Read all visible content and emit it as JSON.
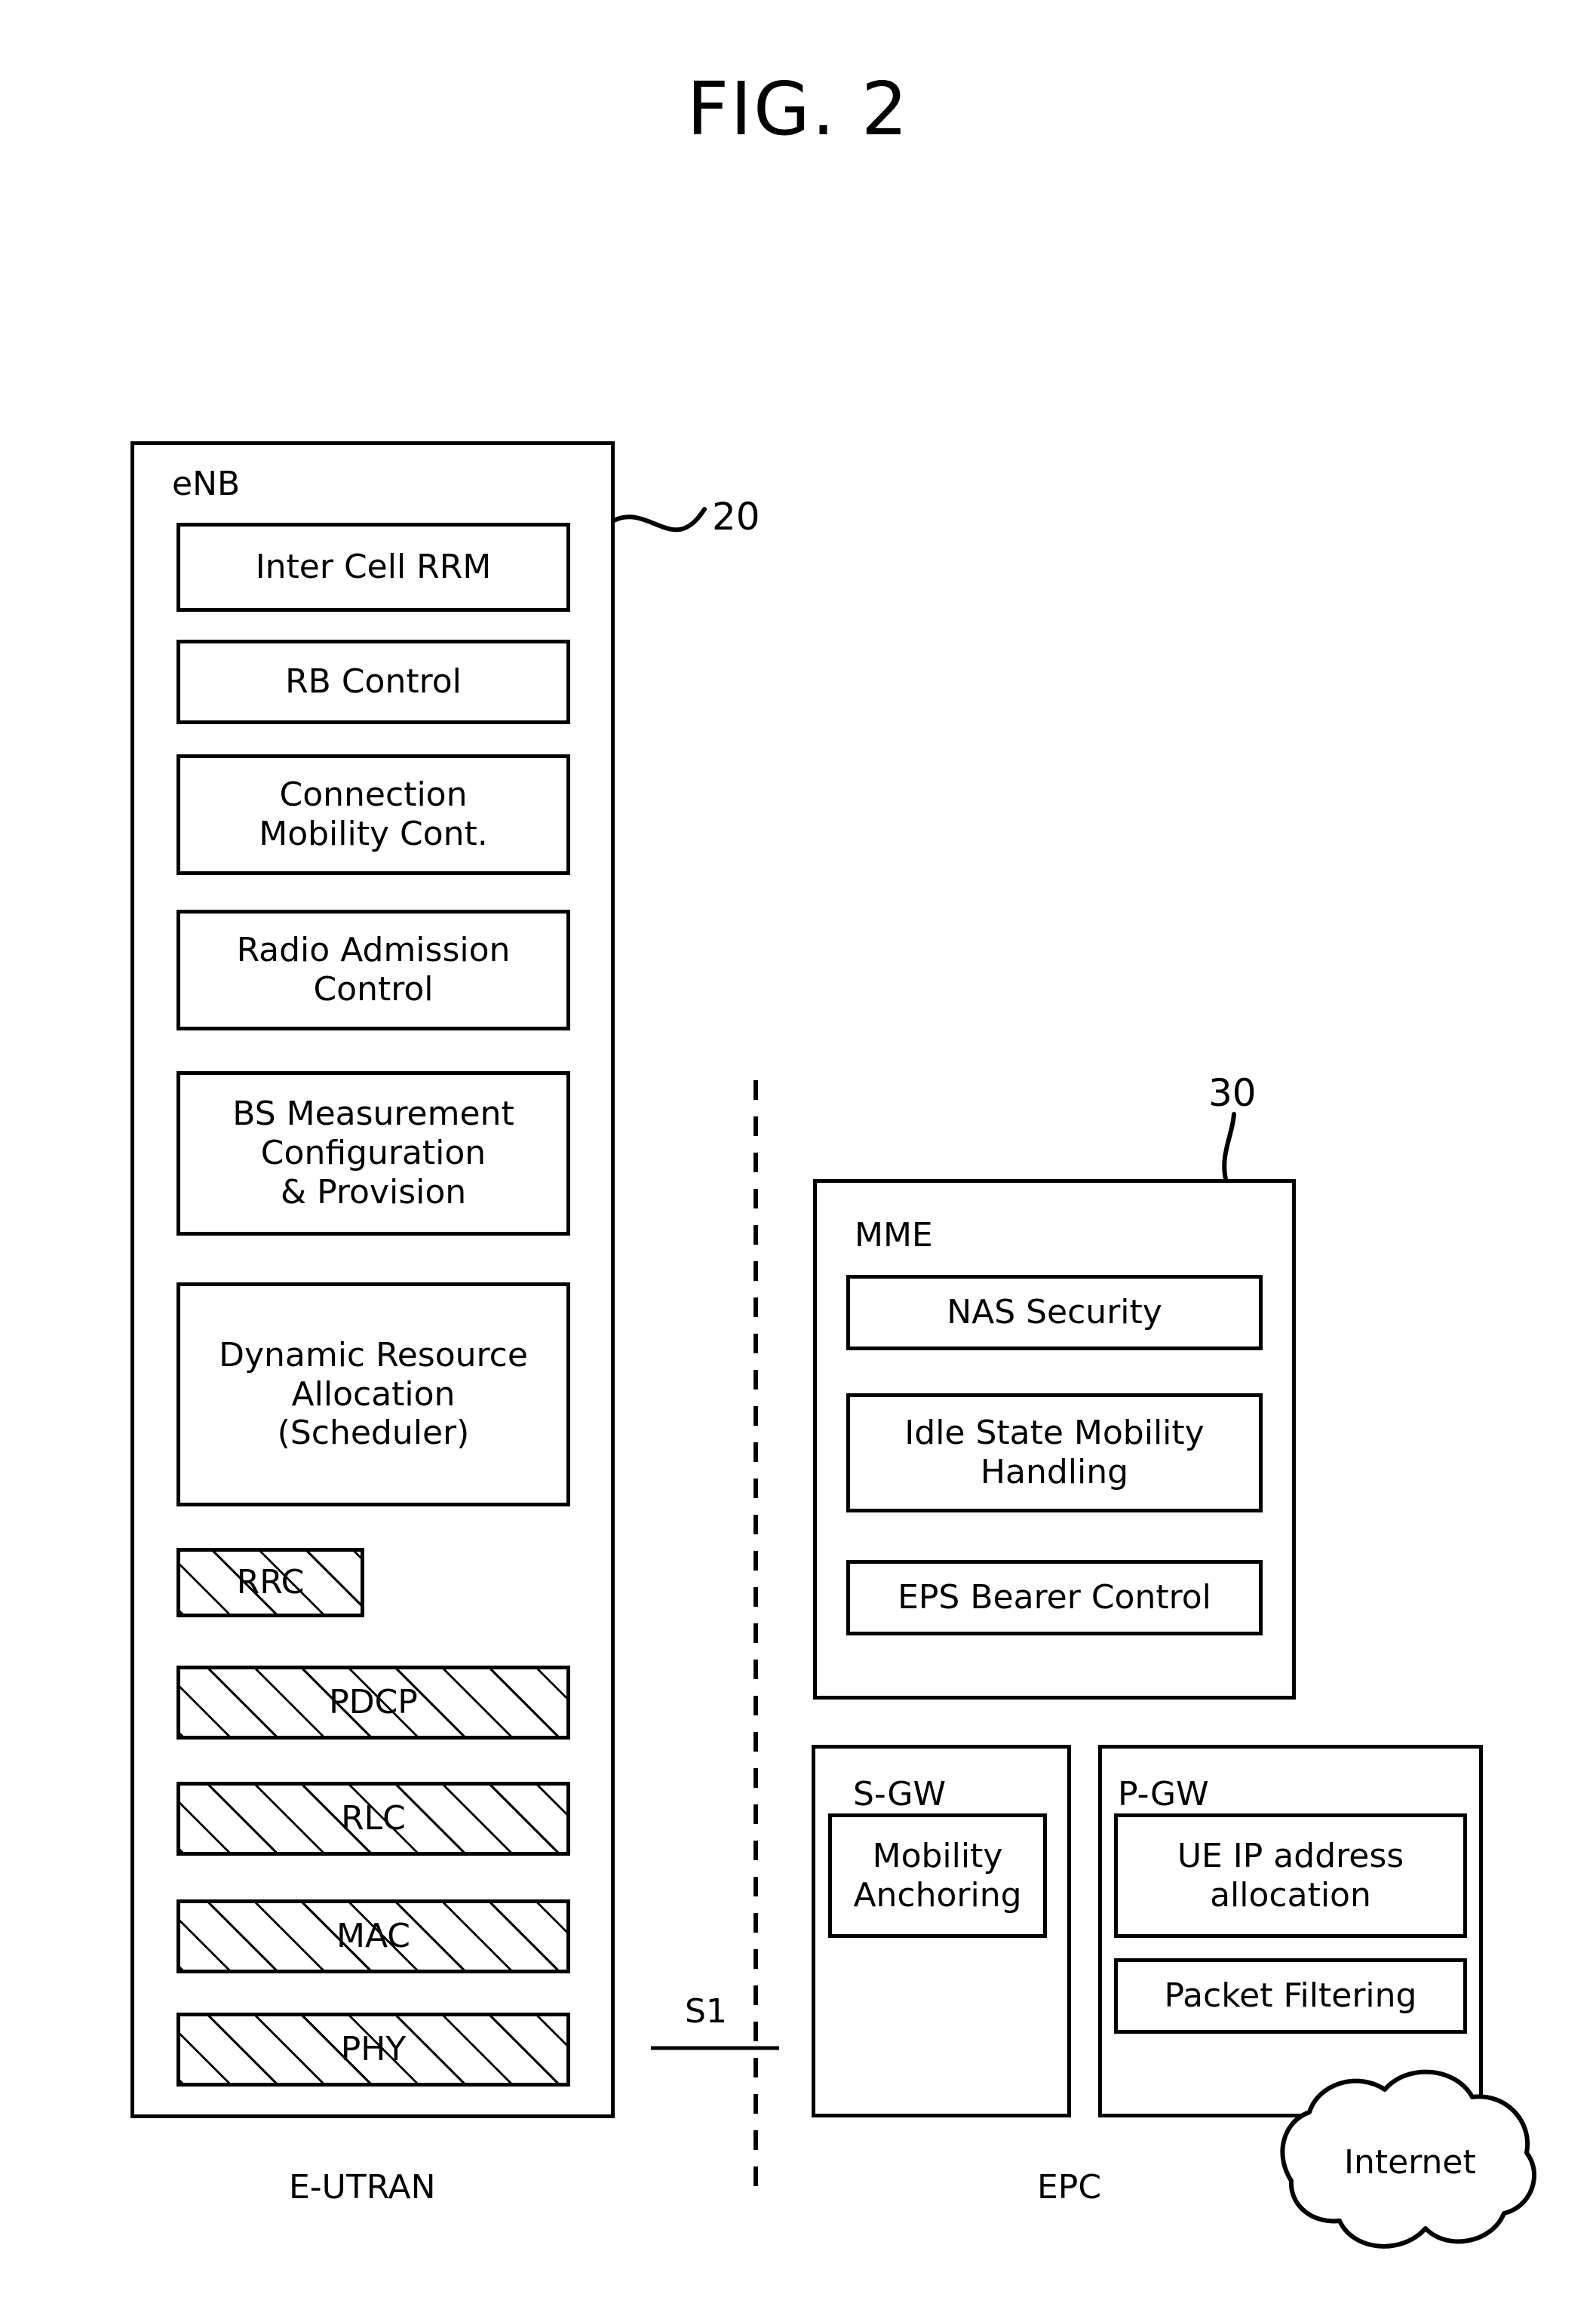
{
  "figure": {
    "title": "FIG. 2",
    "reference_numerals": {
      "enb": "20",
      "mme": "30"
    },
    "interface_label": "S1",
    "domain_labels": {
      "left": "E-UTRAN",
      "right": "EPC"
    },
    "internet_cloud_label": "Internet"
  },
  "enb": {
    "title": "eNB",
    "function_blocks": [
      {
        "label": "Inter Cell RRM"
      },
      {
        "label": "RB Control"
      },
      {
        "label": "Connection\nMobility Cont."
      },
      {
        "label": "Radio Admission\nControl"
      },
      {
        "label": "BS Measurement\nConfiguration\n& Provision"
      },
      {
        "label": "Dynamic Resource\nAllocation\n(Scheduler)"
      }
    ],
    "protocol_stack": [
      {
        "label": "RRC",
        "hatched": true
      },
      {
        "label": "PDCP",
        "hatched": true
      },
      {
        "label": "RLC",
        "hatched": true
      },
      {
        "label": "MAC",
        "hatched": true
      },
      {
        "label": "PHY",
        "hatched": true
      }
    ]
  },
  "mme": {
    "title": "MME",
    "function_blocks": [
      {
        "label": "NAS Security"
      },
      {
        "label": "Idle State Mobility\nHandling"
      },
      {
        "label": "EPS Bearer Control"
      }
    ]
  },
  "sgw": {
    "title": "S-GW",
    "function_blocks": [
      {
        "label": "Mobility\nAnchoring"
      }
    ]
  },
  "pgw": {
    "title": "P-GW",
    "function_blocks": [
      {
        "label": "UE IP address\nallocation"
      },
      {
        "label": "Packet Filtering"
      }
    ]
  },
  "style": {
    "ink": "#000000",
    "paper": "#ffffff"
  }
}
